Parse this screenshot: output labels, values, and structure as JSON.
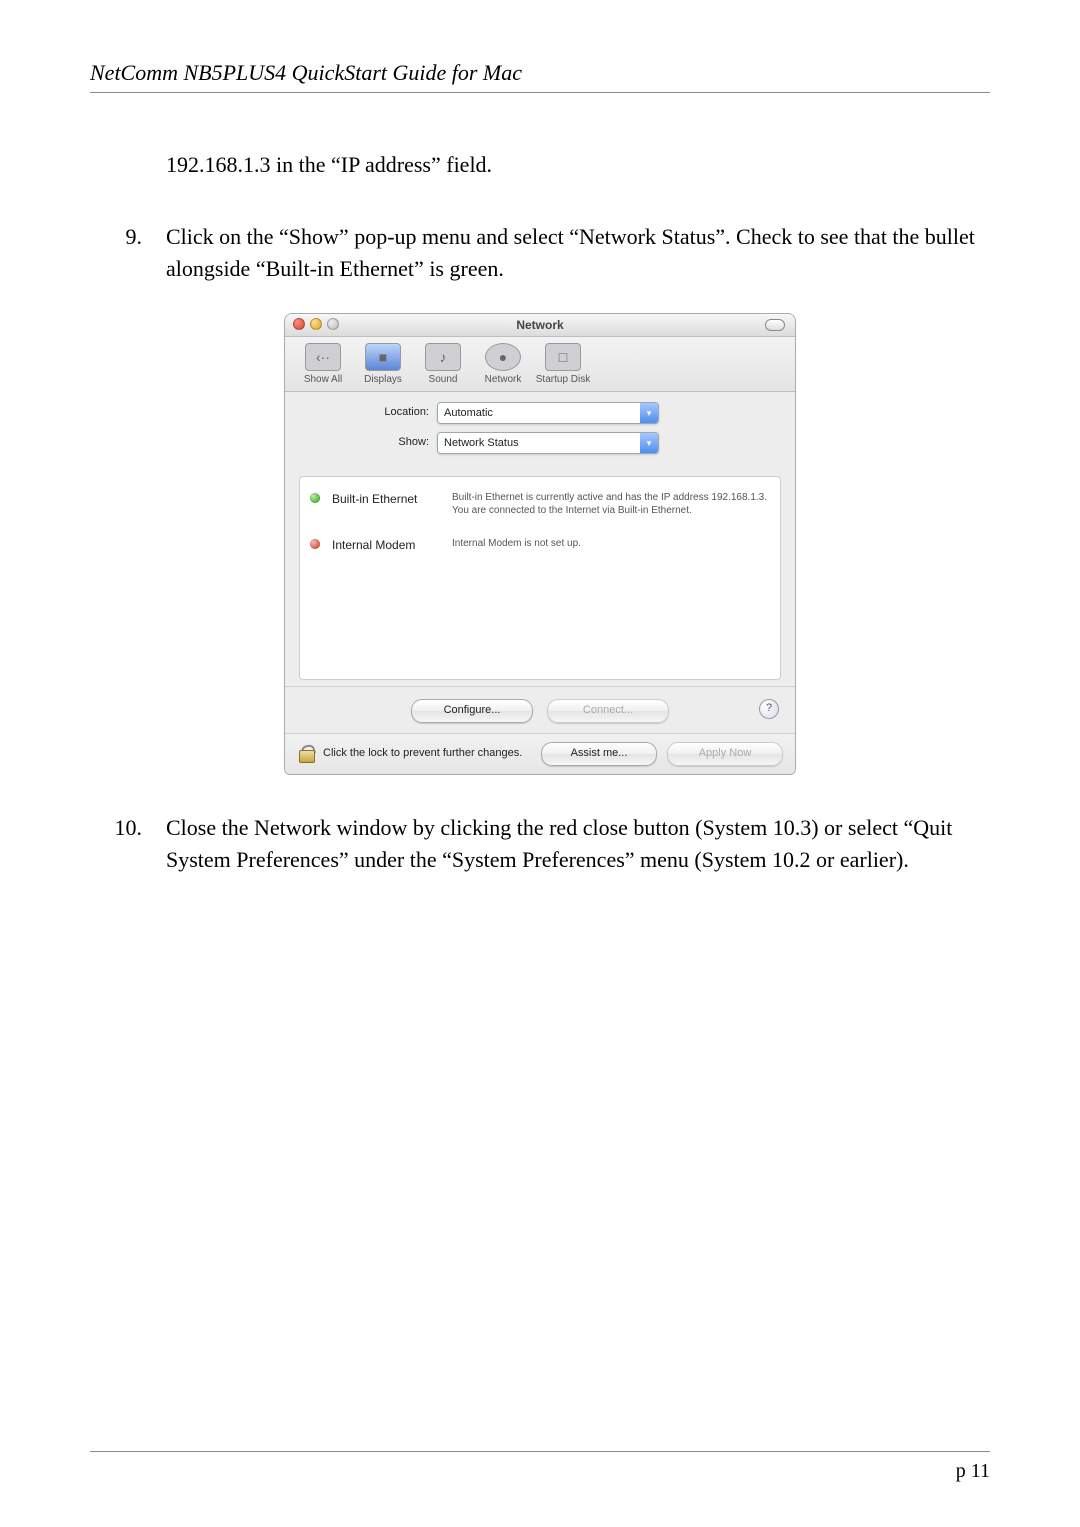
{
  "doc": {
    "header": "NetComm NB5PLUS4 QuickStart Guide for Mac",
    "fragment": "192.168.1.3 in the “IP address” field.",
    "step9_num": "9.",
    "step9": "Click on the “Show” pop-up menu and select “Network Status”. Check to see that the bullet alongside “Built-in Ethernet” is green.",
    "step10_num": "10.",
    "step10": "Close the Network window by clicking the red close button (System 10.3) or select “Quit System Preferences” under the “System Preferences” menu (System 10.2 or earlier).",
    "page_number": "p 11"
  },
  "mac": {
    "title": "Network",
    "toolbar": {
      "items": [
        {
          "icon": "‹··",
          "label": "Show All"
        },
        {
          "icon": "■",
          "label": "Displays"
        },
        {
          "icon": "♪",
          "label": "Sound"
        },
        {
          "icon": "●",
          "label": "Network"
        },
        {
          "icon": "□",
          "label": "Startup Disk"
        }
      ]
    },
    "controls": {
      "location_label": "Location:",
      "location_value": "Automatic",
      "show_label": "Show:",
      "show_value": "Network Status"
    },
    "status": [
      {
        "color": "green",
        "name": "Built-in Ethernet",
        "desc": "Built-in Ethernet is currently active and has the IP address 192.168.1.3. You are connected to the Internet via Built-in Ethernet."
      },
      {
        "color": "red",
        "name": "Internal Modem",
        "desc": "Internal Modem is not set up."
      }
    ],
    "buttons": {
      "configure": "Configure...",
      "connect": "Connect...",
      "assist": "Assist me...",
      "apply": "Apply Now",
      "help": "?"
    },
    "lock_text": "Click the lock to prevent further changes."
  }
}
